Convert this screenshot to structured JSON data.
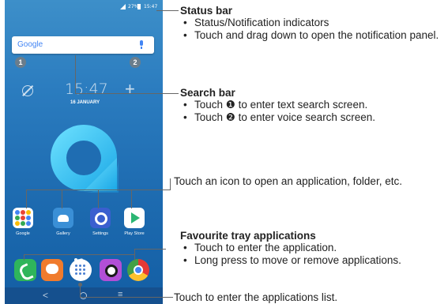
{
  "phone": {
    "status": {
      "battery_pct": "27%",
      "time": "15:47"
    },
    "search": {
      "brand": "Google",
      "marker_1": "❶",
      "marker_2": "❷"
    },
    "clock": {
      "time": "15:47",
      "date": "16 JANUARY"
    },
    "apps": [
      {
        "label": "Google"
      },
      {
        "label": "Gallery"
      },
      {
        "label": "Settings"
      },
      {
        "label": "Play Store"
      }
    ],
    "nav": {
      "back": "<",
      "recent": "≡"
    }
  },
  "callouts": {
    "status_bar": {
      "heading": "Status bar",
      "bullets": [
        "Status/Notification indicators",
        "Touch and drag down to open the notification panel."
      ]
    },
    "search_bar": {
      "heading": "Search bar",
      "bullets": [
        "Touch ❶ to enter text search screen.",
        "Touch ❷ to enter voice search screen."
      ]
    },
    "icon": {
      "text": "Touch an icon to open an application, folder, etc."
    },
    "favourite_tray": {
      "heading": "Favourite tray applications",
      "bullets": [
        "Touch to enter the application.",
        "Long press to move or remove applications."
      ]
    },
    "app_list": {
      "text": "Touch to enter the applications list."
    }
  }
}
